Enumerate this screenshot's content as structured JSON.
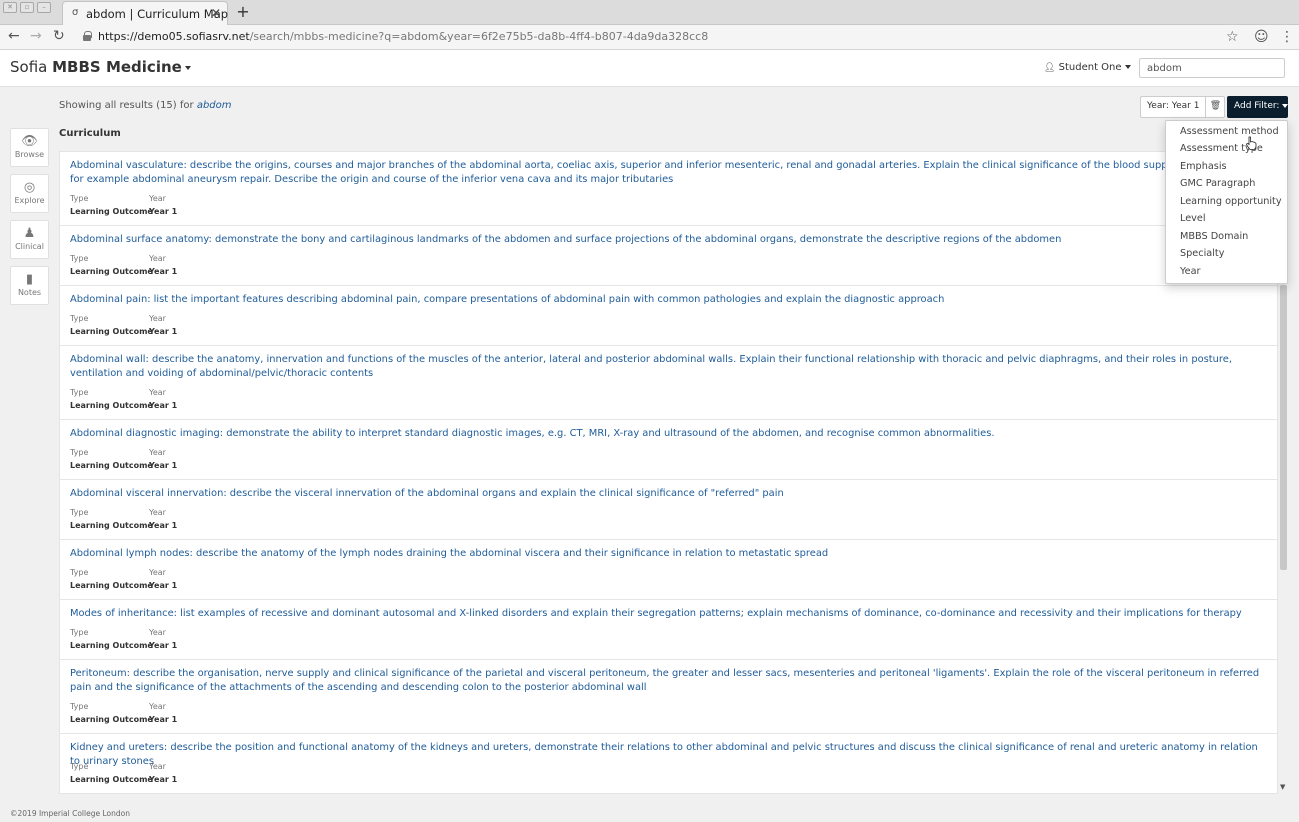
{
  "browser": {
    "tab_title": "abdom | Curriculum Map",
    "url_host": "https://demo05.sofiasrv.net",
    "url_path": "/search/mbbs-medicine?q=abdom&year=6f2e75b5-da8b-4ff4-b807-4da9da328cc8"
  },
  "header": {
    "brand_prefix": "Sofia",
    "brand_name": "MBBS Medicine",
    "user_name": "Student One",
    "search_value": "abdom"
  },
  "rail": [
    {
      "label": "Browse",
      "icon": "eye-icon"
    },
    {
      "label": "Explore",
      "icon": "compass-icon"
    },
    {
      "label": "Clinical",
      "icon": "user-md-icon"
    },
    {
      "label": "Notes",
      "icon": "bookmark-icon"
    }
  ],
  "results_info": {
    "prefix": "Showing all results (15) for",
    "query": "abdom"
  },
  "section_heading": "Curriculum",
  "filters": {
    "active_label": "Year: Year 1",
    "add_label": "Add Filter:",
    "options": [
      "Assessment method",
      "Assessment type",
      "Emphasis",
      "GMC Paragraph",
      "Learning opportunity",
      "Level",
      "MBBS Domain",
      "Specialty",
      "Year"
    ]
  },
  "meta_labels": {
    "type": "Type",
    "year": "Year"
  },
  "results": [
    {
      "title": "Abdominal vasculature: describe the origins, courses and major branches of the abdominal aorta, coeliac axis, superior and inferior mesenteric, renal and gonadal arteries. Explain the clinical significance of the blood supply to the abdomen for example abdominal aneurysm repair. Describe the origin and course of the inferior vena cava and its major tributaries",
      "type": "Learning Outcome",
      "year": "Year 1"
    },
    {
      "title": "Abdominal surface anatomy: demonstrate the bony and cartilaginous landmarks of the abdomen and surface projections of the abdominal organs, demonstrate the descriptive regions of the abdomen",
      "type": "Learning Outcome",
      "year": "Year 1"
    },
    {
      "title": "Abdominal pain: list the important features describing abdominal pain, compare presentations of abdominal pain with common pathologies and explain the diagnostic approach",
      "type": "Learning Outcome",
      "year": "Year 1"
    },
    {
      "title": "Abdominal wall: describe the anatomy, innervation and functions of the muscles of the anterior, lateral and posterior abdominal walls. Explain their functional relationship with thoracic and pelvic diaphragms, and their roles in posture, ventilation and voiding of abdominal/pelvic/thoracic contents",
      "type": "Learning Outcome",
      "year": "Year 1"
    },
    {
      "title": "Abdominal diagnostic imaging: demonstrate the ability to interpret standard diagnostic images, e.g. CT, MRI, X-ray and ultrasound of the abdomen, and recognise common abnormalities.",
      "type": "Learning Outcome",
      "year": "Year 1"
    },
    {
      "title": "Abdominal visceral innervation: describe the visceral innervation of the abdominal organs and explain the clinical significance of \"referred\" pain",
      "type": "Learning Outcome",
      "year": "Year 1"
    },
    {
      "title": "Abdominal lymph nodes: describe the anatomy of the lymph nodes draining the abdominal viscera and their significance in relation to metastatic spread",
      "type": "Learning Outcome",
      "year": "Year 1"
    },
    {
      "title": "Modes of inheritance: list examples of recessive and dominant autosomal and X-linked disorders and explain their segregation patterns; explain mechanisms of dominance, co-dominance and recessivity and their implications for therapy",
      "type": "Learning Outcome",
      "year": "Year 1"
    },
    {
      "title": "Peritoneum: describe the organisation, nerve supply and clinical significance of the parietal and visceral peritoneum, the greater and lesser sacs, mesenteries and peritoneal 'ligaments'. Explain the role of the visceral peritoneum in referred pain and the significance of the attachments of the ascending and descending colon to the posterior abdominal wall",
      "type": "Learning Outcome",
      "year": "Year 1"
    },
    {
      "title": "Kidney and ureters: describe the position and functional anatomy of the kidneys and ureters, demonstrate their relations to other abdominal and pelvic structures and discuss the clinical significance of renal and ureteric anatomy in relation to urinary stones",
      "type": "Learning Outcome",
      "year": "Year 1"
    }
  ],
  "footer": "©2019 Imperial College London"
}
